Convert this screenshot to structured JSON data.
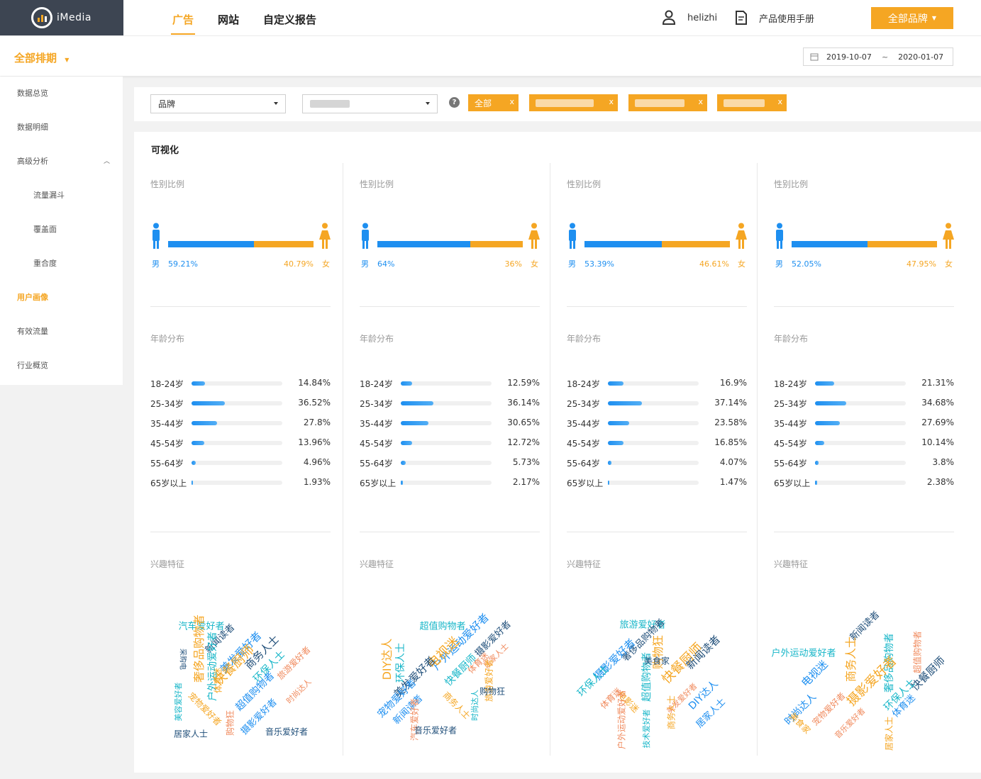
{
  "app": {
    "name": "iMedia"
  },
  "nav": {
    "tabs": [
      "广告",
      "网站",
      "自定义报告"
    ]
  },
  "header": {
    "user": "helizhi",
    "manual": "产品使用手册",
    "brand_button": "全部品牌"
  },
  "subbar": {
    "schedule": "全部排期",
    "date_start": "2019-10-07",
    "date_sep": "~",
    "date_end": "2020-01-07"
  },
  "sidebar": {
    "items": [
      {
        "label": "数据总览"
      },
      {
        "label": "数据明细"
      },
      {
        "label": "高级分析"
      },
      {
        "label": "流量漏斗"
      },
      {
        "label": "覆盖面"
      },
      {
        "label": "重合度"
      },
      {
        "label": "用户画像"
      },
      {
        "label": "有效流量"
      },
      {
        "label": "行业概览"
      }
    ]
  },
  "filters": {
    "dimension": "品牌",
    "chip_all": "全部",
    "chip_close": "x"
  },
  "main": {
    "title": "可视化"
  },
  "labels": {
    "gender": "性别比例",
    "age": "年龄分布",
    "interest": "兴趣特征",
    "male": "男",
    "female": "女"
  },
  "colors": {
    "accent": "#f5a623",
    "male": "#1e8ff0",
    "female": "#f5a623"
  },
  "panels": [
    {
      "male_pct": "59.21%",
      "female_pct": "40.79%",
      "male_ratio": 0.5921,
      "age_labels": [
        "18-24岁",
        "25-34岁",
        "35-44岁",
        "45-54岁",
        "55-64岁",
        "65岁以上"
      ],
      "age_values": [
        "14.84%",
        "36.52%",
        "27.8%",
        "13.96%",
        "4.96%",
        "1.93%"
      ],
      "age_nums": [
        14.84,
        36.52,
        27.8,
        13.96,
        4.96,
        1.93
      ]
    },
    {
      "male_pct": "64%",
      "female_pct": "36%",
      "male_ratio": 0.64,
      "age_labels": [
        "18-24岁",
        "25-34岁",
        "35-44岁",
        "45-54岁",
        "55-64岁",
        "65岁以上"
      ],
      "age_values": [
        "12.59%",
        "36.14%",
        "30.65%",
        "12.72%",
        "5.73%",
        "2.17%"
      ],
      "age_nums": [
        12.59,
        36.14,
        30.65,
        12.72,
        5.73,
        2.17
      ]
    },
    {
      "male_pct": "53.39%",
      "female_pct": "46.61%",
      "male_ratio": 0.5339,
      "age_labels": [
        "18-24岁",
        "25-34岁",
        "35-44岁",
        "45-54岁",
        "55-64岁",
        "65岁以上"
      ],
      "age_values": [
        "16.9%",
        "37.14%",
        "23.58%",
        "16.85%",
        "4.07%",
        "1.47%"
      ],
      "age_nums": [
        16.9,
        37.14,
        23.58,
        16.85,
        4.07,
        1.47
      ]
    },
    {
      "male_pct": "52.05%",
      "female_pct": "47.95%",
      "male_ratio": 0.5205,
      "age_labels": [
        "18-24岁",
        "25-34岁",
        "35-44岁",
        "45-54岁",
        "55-64岁",
        "65岁以上"
      ],
      "age_values": [
        "21.31%",
        "34.68%",
        "27.69%",
        "10.14%",
        "3.8%",
        "2.38%"
      ],
      "age_nums": [
        21.31,
        34.68,
        27.69,
        10.14,
        3.8,
        2.38
      ]
    }
  ],
  "clouds": [
    [
      "汽车爱好者",
      "新闻读者",
      "美发爱好者",
      "奢侈品购物者",
      "户外运动爱好者",
      "快餐厨师",
      "商务人士",
      "环保人士",
      "旅游爱好者",
      "时尚达人",
      "体育迷",
      "超值购物者",
      "摄影爱好者",
      "宠物爱好者",
      "购物狂",
      "美容爱好者",
      "居家人士",
      "音乐爱好者",
      "采购电"
    ],
    [
      "超值购物者",
      "摄影爱好者",
      "户外运动爱好者",
      "DIY达人",
      "环保人士",
      "电视迷",
      "美发爱好者",
      "快餐厨师",
      "体育迷",
      "居家人士",
      "旅游爱好者",
      "宠物爱好者",
      "新闻读者",
      "商务人士",
      "汽车爱好者",
      "时尚达人",
      "音乐爱好者",
      "购物狂"
    ],
    [
      "旅游爱好者",
      "奢侈品购物者",
      "摄影爱好者",
      "购物狂",
      "超值购物者",
      "快餐厨师",
      "新闻读者",
      "环保人士",
      "体育迷",
      "美发爱好者",
      "商务人士",
      "DIY达人",
      "居家人士",
      "电影迷",
      "户外运动爱好者",
      "技术爱好者",
      "美食家"
    ],
    [
      "户外运动爱好者",
      "新闻读者",
      "电视迷",
      "商务人士",
      "奢侈品购物者",
      "摄影爱好者",
      "快餐厨师",
      "环保人士",
      "宠物爱好者",
      "音乐爱好者",
      "居家人士",
      "时尚达人",
      "体育迷",
      "美食家",
      "超值购物者"
    ]
  ]
}
